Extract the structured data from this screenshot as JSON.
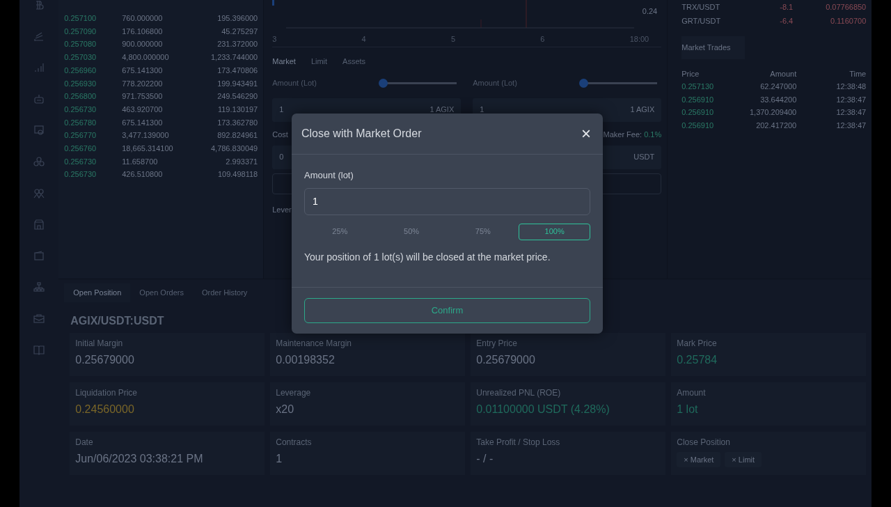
{
  "order_book": {
    "rows": [
      {
        "price": "0.257100",
        "amount": "760.000000",
        "total": "195.396000"
      },
      {
        "price": "0.257090",
        "amount": "176.106800",
        "total": "45.275297"
      },
      {
        "price": "0.257080",
        "amount": "900.000000",
        "total": "231.372000"
      },
      {
        "price": "0.257030",
        "amount": "4,800.000000",
        "total": "1,233.744000"
      },
      {
        "price": "0.256960",
        "amount": "675.141300",
        "total": "173.470806"
      },
      {
        "price": "0.256930",
        "amount": "778.202200",
        "total": "199.943491"
      },
      {
        "price": "0.256800",
        "amount": "971.753500",
        "total": "249.546290"
      },
      {
        "price": "0.256730",
        "amount": "463.920700",
        "total": "119.130197"
      },
      {
        "price": "0.256780",
        "amount": "675.141300",
        "total": "173.362780"
      },
      {
        "price": "0.256770",
        "amount": "3,477.139000",
        "total": "892.824961"
      },
      {
        "price": "0.256760",
        "amount": "18,665.314100",
        "total": "4,786.830049"
      },
      {
        "price": "0.256730",
        "amount": "11.658700",
        "total": "2.993371"
      },
      {
        "price": "0.256730",
        "amount": "426.510800",
        "total": "109.498118"
      }
    ]
  },
  "chart": {
    "x_labels": [
      "3",
      "4",
      "5",
      "6",
      "18:00"
    ],
    "price_label": "0.24"
  },
  "order_form": {
    "tabs": [
      {
        "label": "Market",
        "selected": true
      },
      {
        "label": "Limit",
        "selected": false
      },
      {
        "label": "Assets",
        "selected": false
      }
    ],
    "panels": [
      {
        "amount_label": "Amount (Lot)",
        "level": 0,
        "value": "1",
        "unit": "1 AGIX"
      },
      {
        "amount_label": "Amount (Lot)",
        "level": 0,
        "value": "1",
        "unit": "1 AGIX"
      }
    ],
    "cost_label": "Cost",
    "cost_value": "0",
    "maker_fee_label": "Maker Fee:",
    "maker_fee_value": "0.1%",
    "cost_unit": "USDT",
    "leverage_label": "Lever"
  },
  "markets": [
    {
      "pair": "TRX/USDT",
      "change": "-8.1",
      "price": "0.07766850"
    },
    {
      "pair": "GRT/USDT",
      "change": "-6.4",
      "price": "0.1160700"
    }
  ],
  "market_trades": {
    "tab": "Market Trades",
    "columns": [
      "Price",
      "Amount",
      "Time"
    ],
    "rows": [
      {
        "price": "0.257130",
        "amount": "62.247000",
        "time": "12:38:48"
      },
      {
        "price": "0.256910",
        "amount": "33.644200",
        "time": "12:38:47"
      },
      {
        "price": "0.256910",
        "amount": "1,370.209400",
        "time": "12:38:47"
      },
      {
        "price": "0.256910",
        "amount": "202.417200",
        "time": "12:38:47"
      }
    ]
  },
  "positions": {
    "tabs": [
      {
        "label": "Open Position",
        "selected": true
      },
      {
        "label": "Open Orders",
        "selected": false
      },
      {
        "label": "Order History",
        "selected": false
      }
    ],
    "symbol": "AGIX/USDT:USDT",
    "cards": [
      {
        "kind": "value",
        "label": "Initial Margin",
        "value": "0.25679000"
      },
      {
        "kind": "value",
        "label": "Maintenance Margin",
        "value": "0.00198352"
      },
      {
        "kind": "value",
        "label": "Entry Price",
        "value": "0.25679000"
      },
      {
        "kind": "value",
        "label": "Mark Price",
        "value": "0.25784",
        "color": "#1f6a5c"
      },
      {
        "kind": "value",
        "label": "Liquidation Price",
        "value": "0.24560000",
        "color": "#7a6628"
      },
      {
        "kind": "value",
        "label": "Leverage",
        "value": "x20"
      },
      {
        "kind": "value",
        "label": "Unrealized PNL (ROE)",
        "value": "0.01100000 USDT (4.28%)",
        "color": "#1f6a5c"
      },
      {
        "kind": "value",
        "label": "Amount",
        "value": "1 lot",
        "color": "#1f6a5c"
      },
      {
        "kind": "value",
        "label": "Date",
        "value": "Jun/06/2023 03:38:21 PM"
      },
      {
        "kind": "value",
        "label": "Contracts",
        "value": "1"
      },
      {
        "kind": "value",
        "label": "Take Profit / Stop Loss",
        "value": "- / -"
      },
      {
        "kind": "buttons",
        "label": "Close Position",
        "buttons": [
          {
            "icon": "×",
            "label": "Market"
          },
          {
            "icon": "×",
            "label": "Limit"
          }
        ]
      }
    ]
  },
  "modal": {
    "title": "Close with Market Order",
    "close": "×",
    "amount_label": "Amount (lot)",
    "amount_value": "1",
    "percents": [
      {
        "label": "25%",
        "selected": false
      },
      {
        "label": "50%",
        "selected": false
      },
      {
        "label": "75%",
        "selected": false
      },
      {
        "label": "100%",
        "selected": true
      }
    ],
    "message": "Your position of 1 lot(s) will be closed at the market price.",
    "confirm": "Confirm"
  }
}
